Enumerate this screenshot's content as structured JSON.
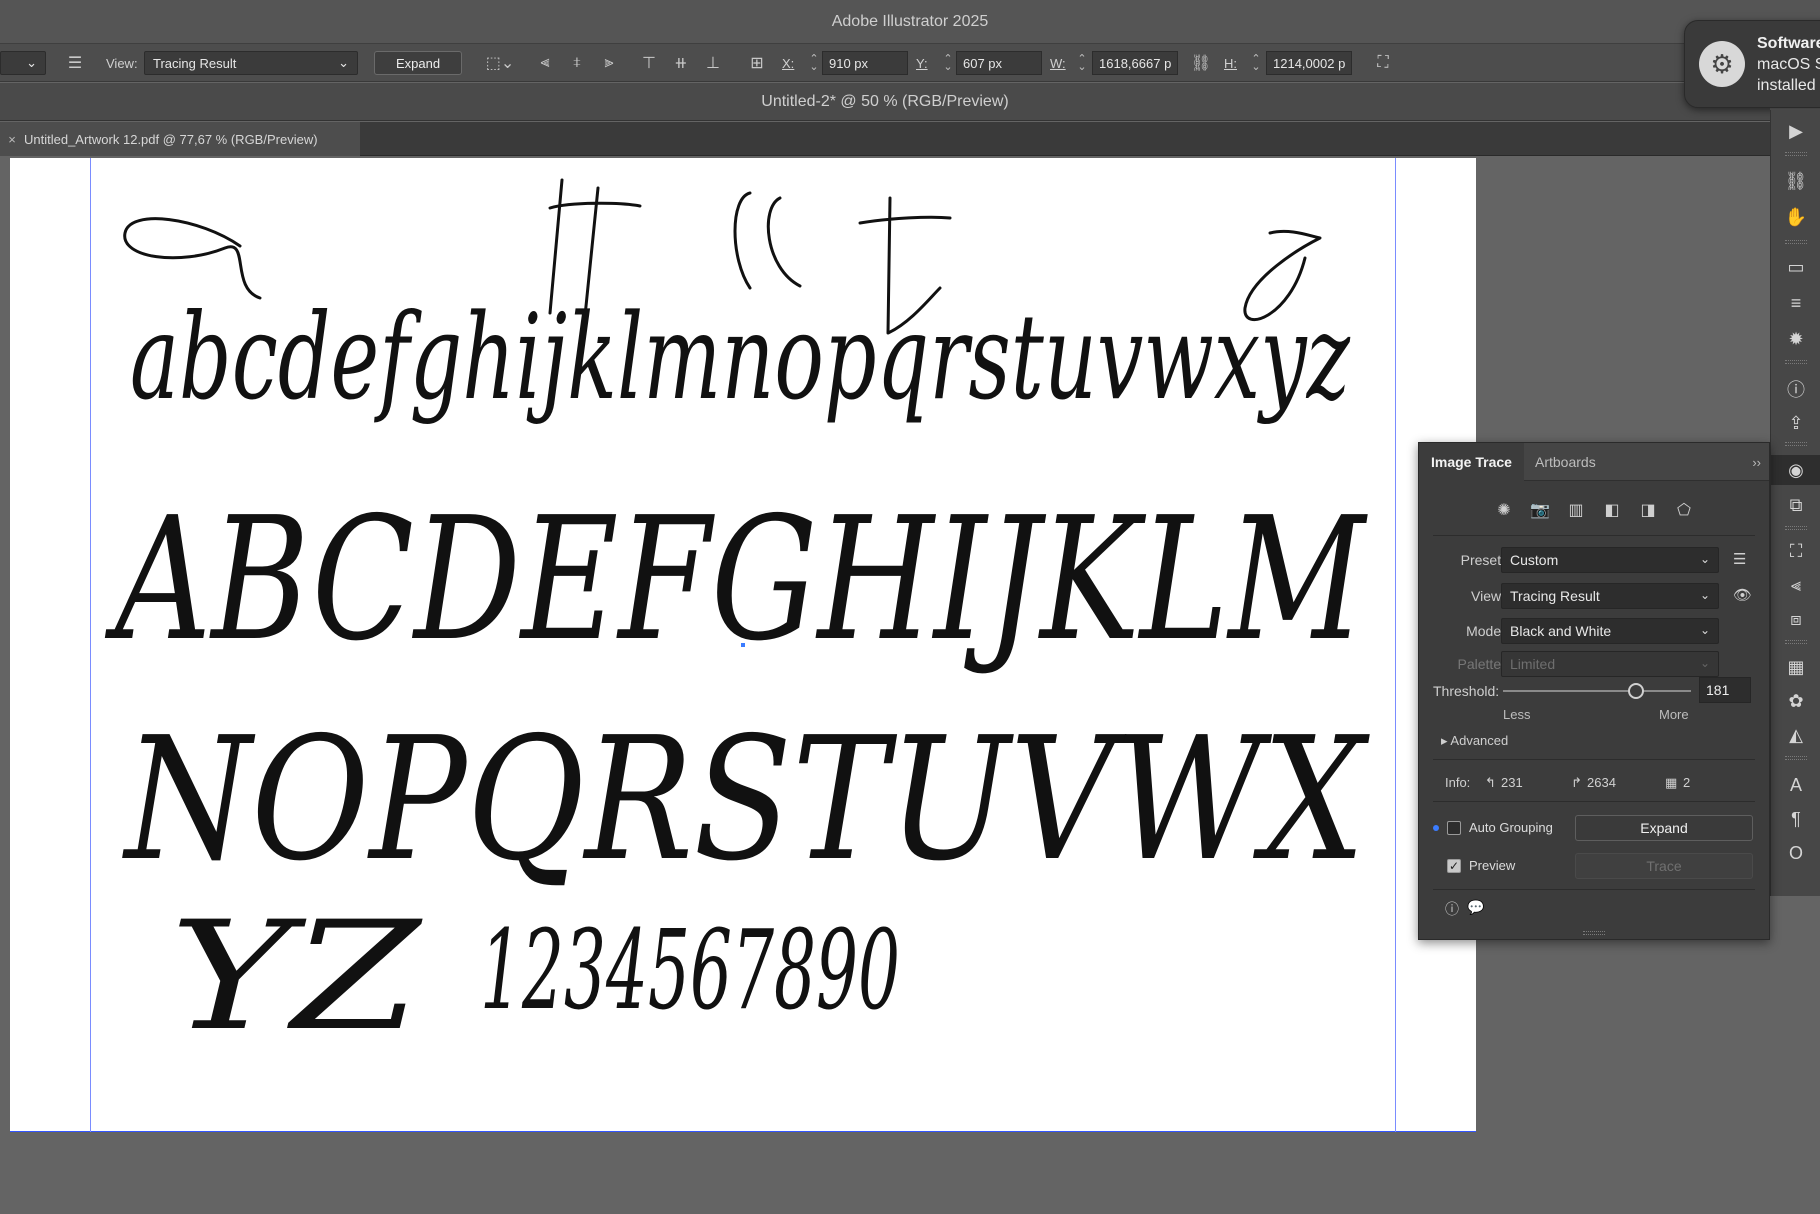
{
  "app": {
    "title": "Adobe Illustrator 2025"
  },
  "control_bar": {
    "view_label": "View:",
    "view_value": "Tracing Result",
    "expand_label": "Expand",
    "x_label": "X:",
    "x_value": "910 px",
    "y_label": "Y:",
    "y_value": "607 px",
    "w_label": "W:",
    "w_value": "1618,6667 p",
    "h_label": "H:",
    "h_value": "1214,0002 p"
  },
  "document": {
    "title": "Untitled-2* @ 50 % (RGB/Preview)",
    "tab_label": "Untitled_Artwork 12.pdf @ 77,67 % (RGB/Preview)",
    "tab_close": "×"
  },
  "notification": {
    "line1": "Software",
    "line2": "macOS S",
    "line3": "installed"
  },
  "image_trace": {
    "tabs": [
      "Image Trace",
      "Artboards"
    ],
    "preset_label": "Preset:",
    "preset_value": "Custom",
    "view_label": "View:",
    "view_value": "Tracing Result",
    "mode_label": "Mode:",
    "mode_value": "Black and White",
    "palette_label": "Palette:",
    "palette_value": "Limited",
    "threshold_label": "Threshold:",
    "threshold_value": "181",
    "threshold_fraction": 0.71,
    "less_label": "Less",
    "more_label": "More",
    "advanced_label": "Advanced",
    "info_label": "Info:",
    "info_paths": "231",
    "info_anchors": "2634",
    "info_colors": "2",
    "auto_grouping_label": "Auto Grouping",
    "expand_button": "Expand",
    "preview_label": "Preview",
    "trace_button": "Trace"
  },
  "artwork": {
    "lowercase": "abcdefghijklmnopqrstuvwxyz",
    "uppercase_row1": "ABCDEFGHIJKLM",
    "uppercase_row2": "NOPQRSTUVWX",
    "uppercase_row3": "YZ",
    "digits": "1234567890"
  }
}
